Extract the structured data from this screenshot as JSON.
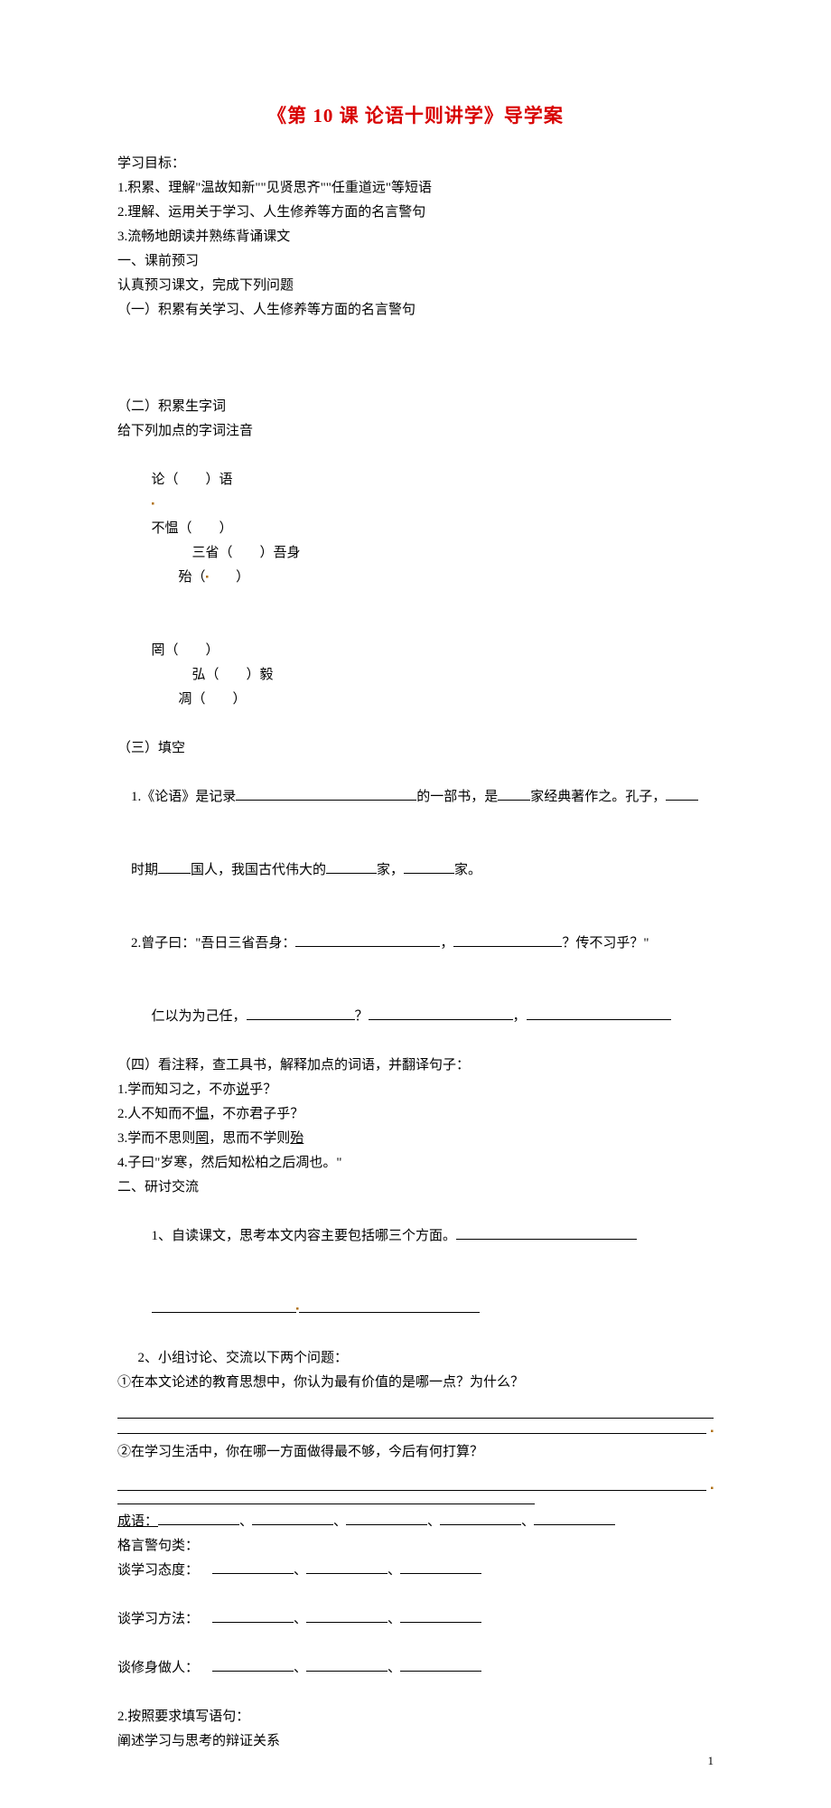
{
  "title": "《第 10 课 论语十则讲学》导学案",
  "heading_goals": "学习目标：",
  "goals": [
    "1.积累、理解\"温故知新\"\"见贤思齐\"\"任重道远\"等短语",
    "2.理解、运用关于学习、人生修养等方面的名言警句",
    "3.流畅地朗读并熟练背诵课文"
  ],
  "sec1_title": "一、课前预习",
  "sec1_intro": "认真预习课文，完成下列问题",
  "sub1": "（一）积累有关学习、人生修养等方面的名言警句",
  "sub2": "（二）积累生字词",
  "sub2_line": "给下列加点的字词注音",
  "pinyin1_a": "论（",
  "pinyin1_b": "）语",
  "pinyin1_c": "不愠（",
  "pinyin1_d": "）",
  "pinyin1_e": "三省（",
  "pinyin1_f": "）吾身",
  "pinyin1_g": "殆（",
  "pinyin1_h": "）",
  "pinyin2_a": "罔（",
  "pinyin2_b": "）",
  "pinyin2_c": "弘（",
  "pinyin2_d": "）毅",
  "pinyin2_e": "凋（",
  "pinyin2_f": "）",
  "sub3": "（三）填空",
  "fill1_a": "1.《论语》是记录",
  "fill1_b": "的一部书，是",
  "fill1_c": "家经典著作之。孔子，",
  "fill1_d": "时期",
  "fill1_e": "国人，我国古代伟大的",
  "fill1_f": "家，",
  "fill1_g": "家。",
  "fill2_a": "2.曾子曰：\"吾日三省吾身：",
  "fill2_b": "，",
  "fill2_c": "？传不习乎？\"",
  "fill2_d": "仁以为为己任，",
  "fill2_e": "？",
  "fill2_f": "，",
  "sub4": "（四）看注释，查工具书，解释加点的词语，并翻译句子：",
  "q4": [
    "1.学而知习之，不亦",
    "说",
    "乎？",
    "2.人不知而不",
    "愠",
    "，不亦君子乎？",
    "3.学而不思则",
    "罔",
    "，思而不学则",
    "殆",
    "4.子曰\"岁寒，然后知松柏之后凋也。\""
  ],
  "sec2_title": "二、研讨交流",
  "sec2_q1": "1、自读课文，思考本文内容主要包括哪三个方面。",
  "sec2_q2": "2、小组讨论、交流以下两个问题：",
  "sec2_q2a": "①在本文论述的教育思想中，你认为最有价值的是哪一点？为什么？",
  "sec2_q2b": "②在学习生活中，你在哪一方面做得最不够，今后有何打算？",
  "idiom_label": "成语：",
  "aphorism_label": "格言警句类：",
  "cat1": "谈学习态度：",
  "cat2": "谈学习方法：",
  "cat3": "谈修身做人：",
  "q2b_req": "2.按照要求填写语句：",
  "q2b_req2": "阐述学习与思考的辩证关系",
  "pagenum": "1"
}
